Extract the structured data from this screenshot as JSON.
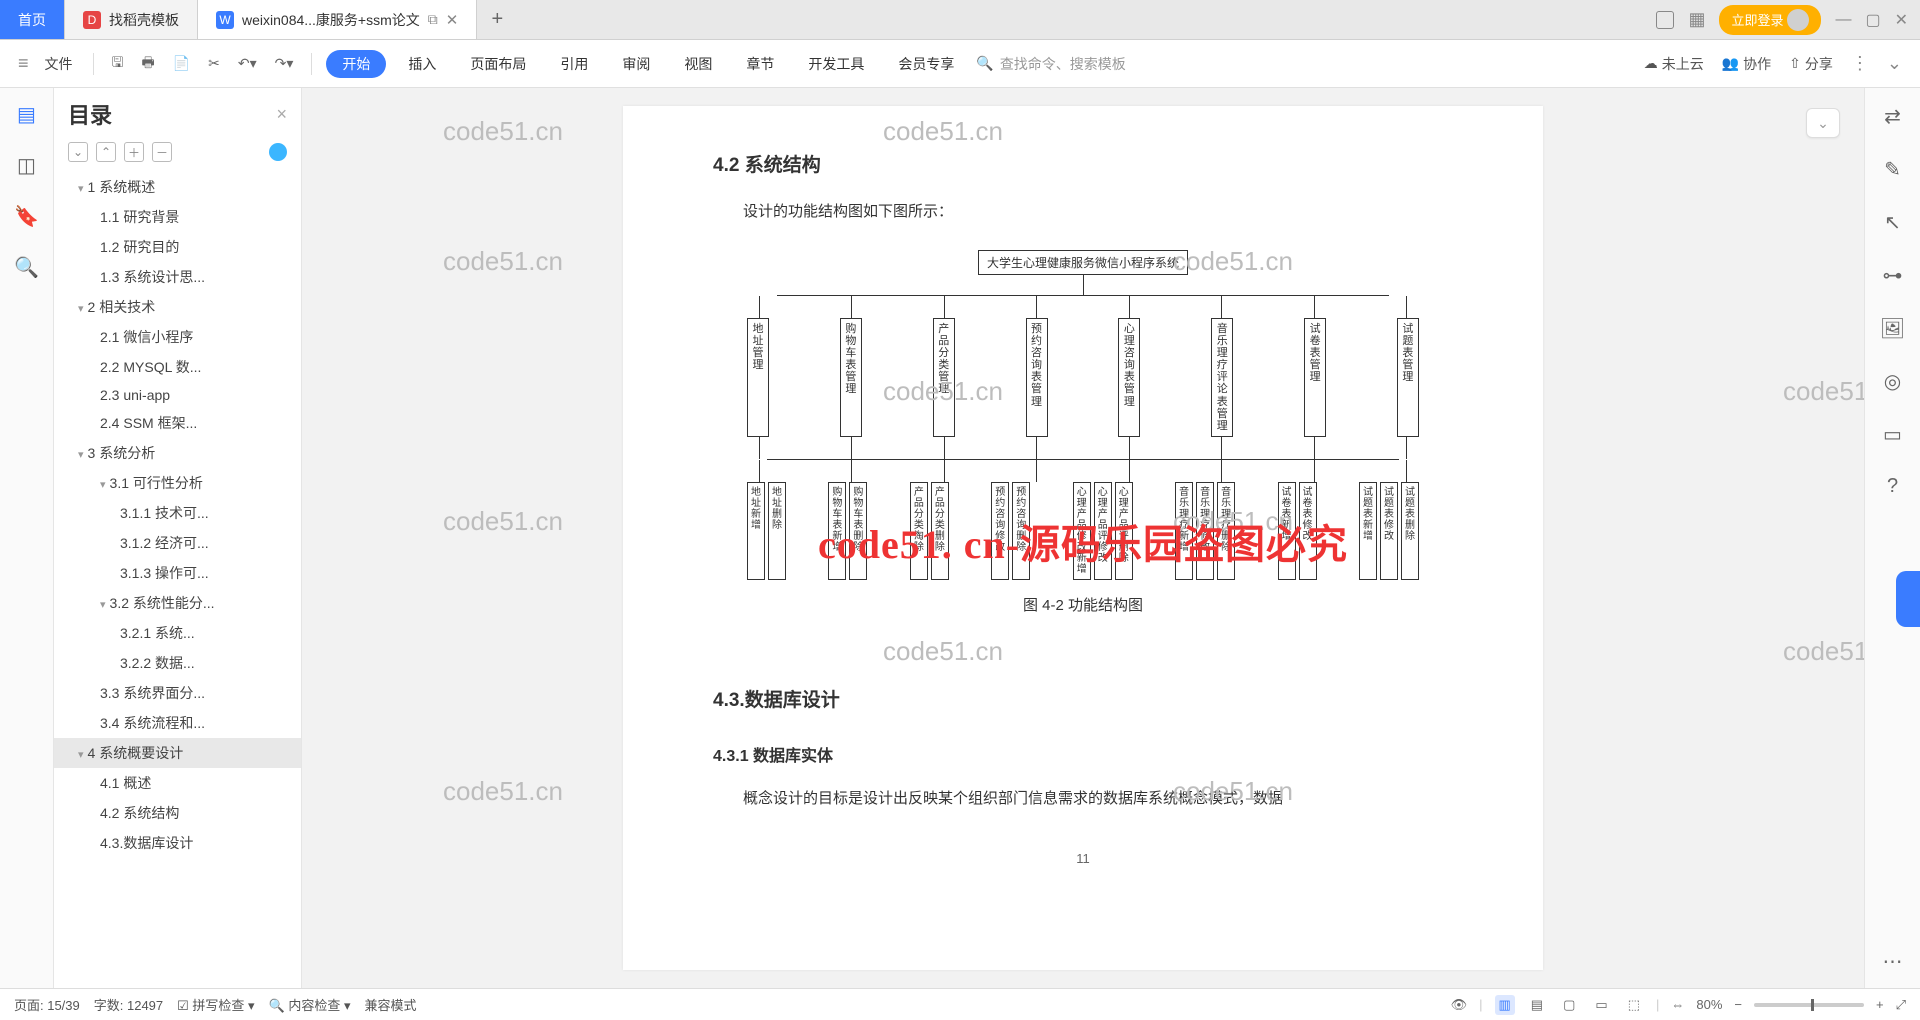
{
  "tabs": {
    "home": "首页",
    "t1": "找稻壳模板",
    "t2": "weixin084...康服务+ssm论文",
    "add": "+"
  },
  "titlebar": {
    "login": "立即登录"
  },
  "ribbon": {
    "file": "文件",
    "tabs": [
      "开始",
      "插入",
      "页面布局",
      "引用",
      "审阅",
      "视图",
      "章节",
      "开发工具",
      "会员专享"
    ],
    "search_ph": "查找命令、搜索模板",
    "cloud": "未上云",
    "coop": "协作",
    "share": "分享"
  },
  "outline": {
    "title": "目录",
    "items": [
      {
        "lvl": 1,
        "chev": "▾",
        "txt": "1 系统概述"
      },
      {
        "lvl": 2,
        "txt": "1.1 研究背景"
      },
      {
        "lvl": 2,
        "txt": "1.2 研究目的"
      },
      {
        "lvl": 2,
        "txt": "1.3 系统设计思..."
      },
      {
        "lvl": 1,
        "chev": "▾",
        "txt": "2 相关技术"
      },
      {
        "lvl": 2,
        "txt": "2.1 微信小程序"
      },
      {
        "lvl": 2,
        "txt": "2.2 MYSQL 数..."
      },
      {
        "lvl": 2,
        "txt": "2.3 uni-app"
      },
      {
        "lvl": 2,
        "txt": "2.4 SSM 框架..."
      },
      {
        "lvl": 1,
        "chev": "▾",
        "txt": "3 系统分析"
      },
      {
        "lvl": 2,
        "chev": "▾",
        "txt": "3.1 可行性分析"
      },
      {
        "lvl": 3,
        "txt": "3.1.1 技术可..."
      },
      {
        "lvl": 3,
        "txt": "3.1.2 经济可..."
      },
      {
        "lvl": 3,
        "txt": "3.1.3 操作可..."
      },
      {
        "lvl": 2,
        "chev": "▾",
        "txt": "3.2 系统性能分..."
      },
      {
        "lvl": 3,
        "txt": "3.2.1  系统..."
      },
      {
        "lvl": 3,
        "txt": "3.2.2  数据..."
      },
      {
        "lvl": 2,
        "txt": "3.3 系统界面分..."
      },
      {
        "lvl": 2,
        "txt": "3.4 系统流程和..."
      },
      {
        "lvl": 1,
        "chev": "▾",
        "txt": "4 系统概要设计",
        "sel": true
      },
      {
        "lvl": 2,
        "txt": "4.1 概述"
      },
      {
        "lvl": 2,
        "txt": "4.2 系统结构"
      },
      {
        "lvl": 2,
        "txt": "4.3.数据库设计"
      }
    ]
  },
  "doc": {
    "h42": "4.2 系统结构",
    "p1": "设计的功能结构图如下图所示：",
    "org_root": "大学生心理健康服务微信小程序系统",
    "org_mid": [
      "地址管理",
      "购物车表管理",
      "产品分类管理",
      "预约咨询表管理",
      "心理咨询表管理",
      "音乐理疗评论表管理",
      "试卷表管理",
      "试题表管理"
    ],
    "org_leaf_groups": [
      [
        "地址新增",
        "地址删除"
      ],
      [
        "购物车表新增",
        "购物车表删除"
      ],
      [
        "产品分类淘除",
        "产品分类删除"
      ],
      [
        "预约咨询修改",
        "预约咨询删除"
      ],
      [
        "心理产品修改新增",
        "心理产品评修改",
        "心理产品评删除"
      ],
      [
        "音乐理疗新增",
        "音乐理疗修改",
        "音乐理疗删除"
      ],
      [
        "试卷表新增",
        "试卷表修改"
      ],
      [
        "试题表新增",
        "试题表修改",
        "试题表删除"
      ]
    ],
    "figcap": "图 4-2 功能结构图",
    "h43": "4.3.数据库设计",
    "h431": "4.3.1 数据库实体",
    "p2": "概念设计的目标是设计出反映某个组织部门信息需求的数据库系统概念模式，数据",
    "pagenum": "11",
    "watermark": "code51.cn",
    "redwm": "code51. cn-源码乐园盗图必究"
  },
  "status": {
    "page": "页面: 15/39",
    "words": "字数: 12497",
    "spell": "拼写检查",
    "content": "内容检查",
    "compat": "兼容模式",
    "zoom": "80%"
  }
}
